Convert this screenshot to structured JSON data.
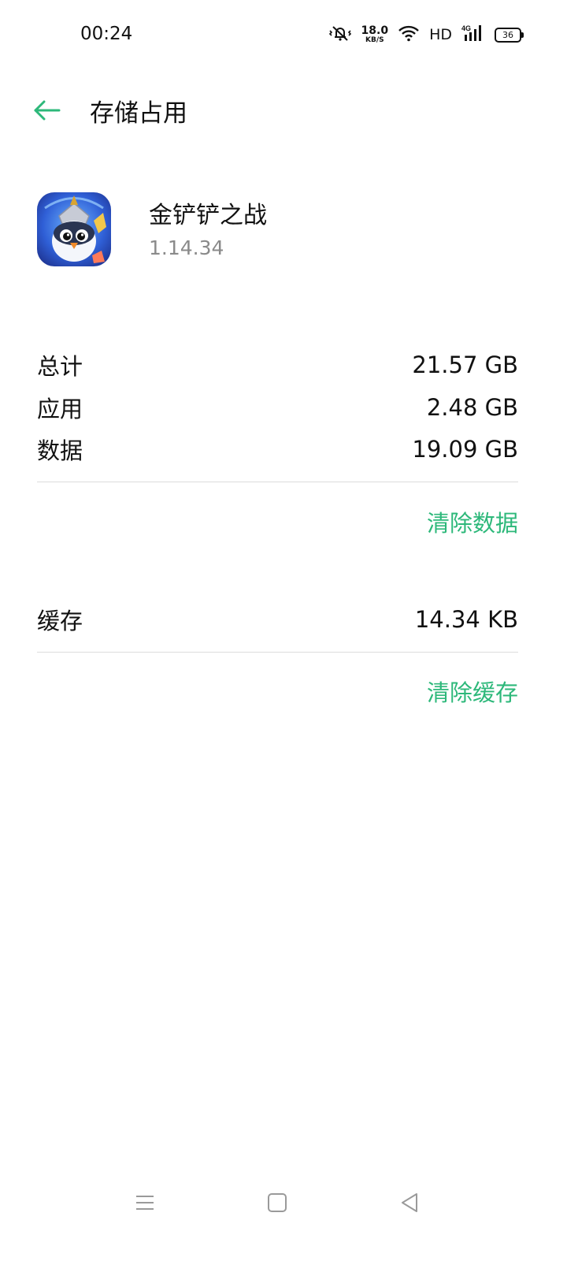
{
  "status_bar": {
    "time": "00:24",
    "net_speed": "18.0",
    "net_unit": "KB/S",
    "hd": "HD",
    "network": "4G",
    "battery": "36"
  },
  "header": {
    "title": "存储占用"
  },
  "app": {
    "name": "金铲铲之战",
    "version": "1.14.34"
  },
  "storage": {
    "rows": [
      {
        "label": "总计",
        "value": "21.57 GB"
      },
      {
        "label": "应用",
        "value": "2.48 GB"
      },
      {
        "label": "数据",
        "value": "19.09 GB"
      }
    ],
    "clear_data_label": "清除数据",
    "cache_label": "缓存",
    "cache_value": "14.34 KB",
    "clear_cache_label": "清除缓存"
  },
  "colors": {
    "accent": "#2db87a",
    "text": "#111111",
    "secondary": "#8a8a8a",
    "divider": "#dcdcdc"
  },
  "icons": [
    "mute-vibrate-icon",
    "wifi-icon",
    "signal-icon",
    "battery-icon",
    "back-arrow-icon",
    "menu-icon",
    "home-icon",
    "back-icon"
  ]
}
